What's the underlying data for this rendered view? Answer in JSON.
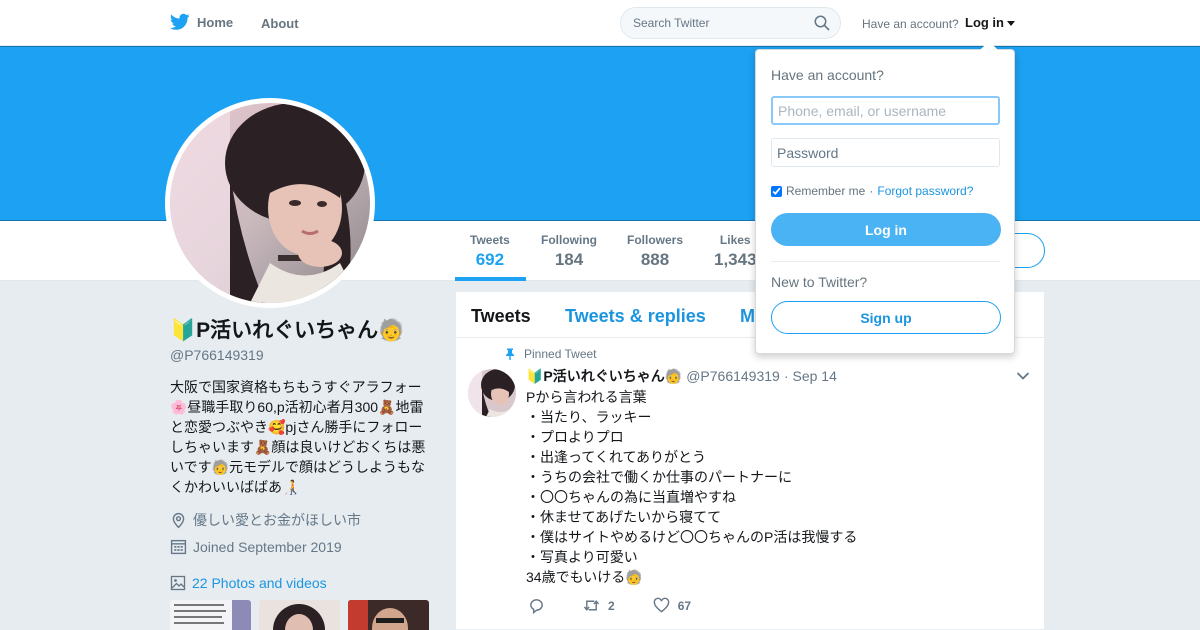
{
  "nav": {
    "home_label": "Home",
    "about_label": "About",
    "search_placeholder": "Search Twitter",
    "have_account": "Have an account?",
    "login_label": "Log in"
  },
  "colors": {
    "brand": "#1da1f2",
    "link": "#1b95e0",
    "text": "#14171a",
    "muted": "#657786",
    "page_bg": "#e6ecf0"
  },
  "stats": [
    {
      "label": "Tweets",
      "value": "692",
      "active": true
    },
    {
      "label": "Following",
      "value": "184",
      "active": false
    },
    {
      "label": "Followers",
      "value": "888",
      "active": false
    },
    {
      "label": "Likes",
      "value": "1,343",
      "active": false
    }
  ],
  "profile": {
    "name": "🔰P活いれぐいちゃん🧓",
    "handle": "@P766149319",
    "bio": "大阪で国家資格もちもうすぐアラフォー🌸昼職手取り60,p活初心者月300🧸地雷と恋愛つぶやき🥰pjさん勝手にフォローしちゃいます🧸顔は良いけどおくちは悪いです🧓元モデルで顔はどうしようもなくかわいいばばあ🧑‍🦯",
    "location": "優しい愛とお金がほしい市",
    "joined": "Joined September 2019",
    "photos_link": "22 Photos and videos",
    "location_icon": "location-pin-icon",
    "joined_icon": "calendar-icon",
    "photos_icon": "image-icon"
  },
  "timeline": {
    "tabs": [
      "Tweets",
      "Tweets & replies",
      "Media"
    ],
    "tweet": {
      "pinned_label": "Pinned Tweet",
      "author_name": "🔰P活いれぐいちゃん🧓",
      "author_handle": "@P766149319",
      "date_sep": "·",
      "date": "Sep 14",
      "lines": [
        "Pから言われる言葉",
        "・当たり、ラッキー",
        "・プロよりプロ",
        "・出逢ってくれてありがとう",
        "・うちの会社で働くか仕事のパートナーに",
        "・〇〇ちゃんの為に当直増やすね",
        "・休ませてあげたいから寝てて",
        "・僕はサイトやめるけど〇〇ちゃんのP活は我慢する",
        "・写真より可愛い",
        "34歳でもいける🧓"
      ],
      "retweets": "2",
      "likes": "67"
    }
  },
  "login_dropdown": {
    "title": "Have an account?",
    "username_placeholder": "Phone, email, or username",
    "password_placeholder": "Password",
    "remember_label": "Remember me",
    "separator": "·",
    "forgot_label": "Forgot password?",
    "login_button": "Log in",
    "new_label": "New to Twitter?",
    "signup_button": "Sign up"
  }
}
